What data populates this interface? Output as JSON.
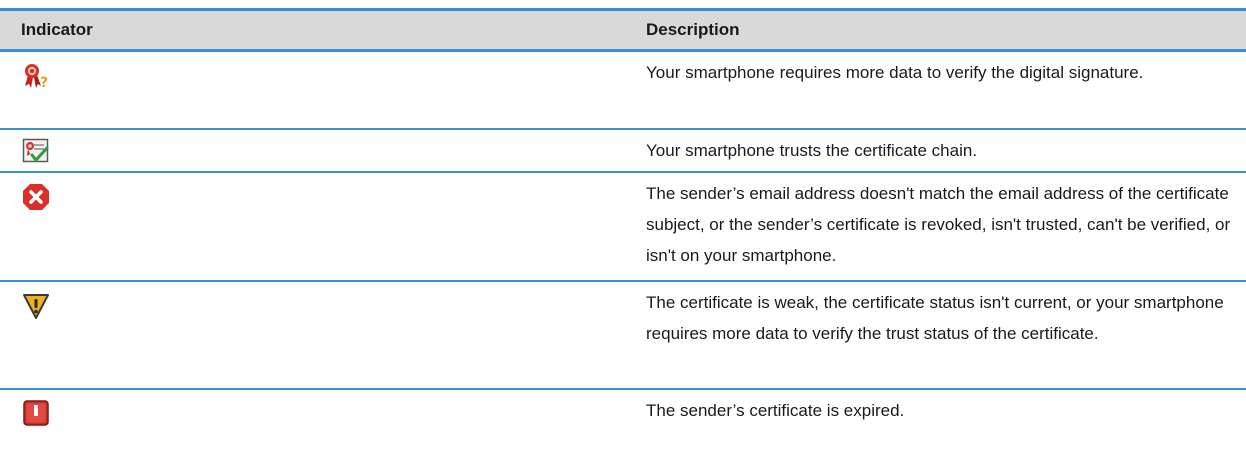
{
  "table": {
    "headers": {
      "indicator": "Indicator",
      "description": "Description"
    },
    "rows": [
      {
        "icon": "ribbon-question-icon",
        "description": "Your smartphone requires more data to verify the digital signature."
      },
      {
        "icon": "certificate-check-icon",
        "description": "Your smartphone trusts the certificate chain."
      },
      {
        "icon": "red-x-error-icon",
        "description": "The sender’s email address doesn't match the email address of the certificate subject, or the sender’s certificate is revoked, isn't trusted, can't be verified, or isn't on your smartphone."
      },
      {
        "icon": "yellow-warning-icon",
        "description": "The certificate is weak, the certificate status isn't current, or your smartphone requires more data to verify the trust status of the certificate."
      },
      {
        "icon": "red-expired-icon",
        "description": "The sender’s certificate is expired."
      }
    ]
  },
  "colors": {
    "rule": "#3b8fd4",
    "header_bg": "#d9d9d9",
    "error_red": "#d9312a",
    "warning_yellow": "#f0b21c"
  }
}
